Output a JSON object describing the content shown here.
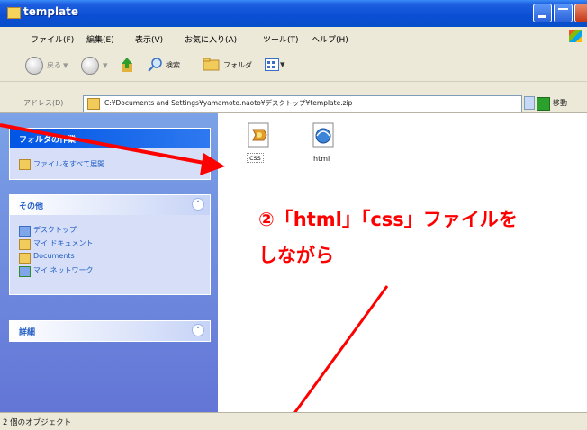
{
  "window": {
    "title": "template"
  },
  "menu": [
    "ファイル(F)",
    "編集(E)",
    "表示(V)",
    "お気に入り(A)",
    "ツール(T)",
    "ヘルプ(H)"
  ],
  "toolbar": {
    "back_label": "戻る",
    "search_label": "検索",
    "folder_label": "フォルダ"
  },
  "address": {
    "label": "アドレス(D)",
    "value": "C:¥Documents and Settings¥yamamoto.naoto¥デスクトップ¥template.zip",
    "go_label": "移動"
  },
  "tasks": {
    "folder_tasks": {
      "title": "フォルダの作業",
      "items": [
        "ファイルをすべて展開"
      ]
    },
    "other": {
      "title": "その他",
      "items": [
        "デスクトップ",
        "マイ ドキュメント",
        "Documents",
        "マイ ネットワーク"
      ]
    },
    "details": {
      "title": "詳細"
    }
  },
  "files": [
    {
      "name": "css",
      "icon": "zip-css-file-icon"
    },
    {
      "name": "html",
      "icon": "html-file-icon"
    }
  ],
  "annotation": {
    "line1": "②「html」「css」ファイルを",
    "line2": "しながら"
  },
  "status": {
    "text": "2 個のオブジェクト"
  },
  "colors": {
    "annotation": "#FF0000",
    "titlebar": "#0A4ED4",
    "taskpane": "#6F8BDF"
  }
}
